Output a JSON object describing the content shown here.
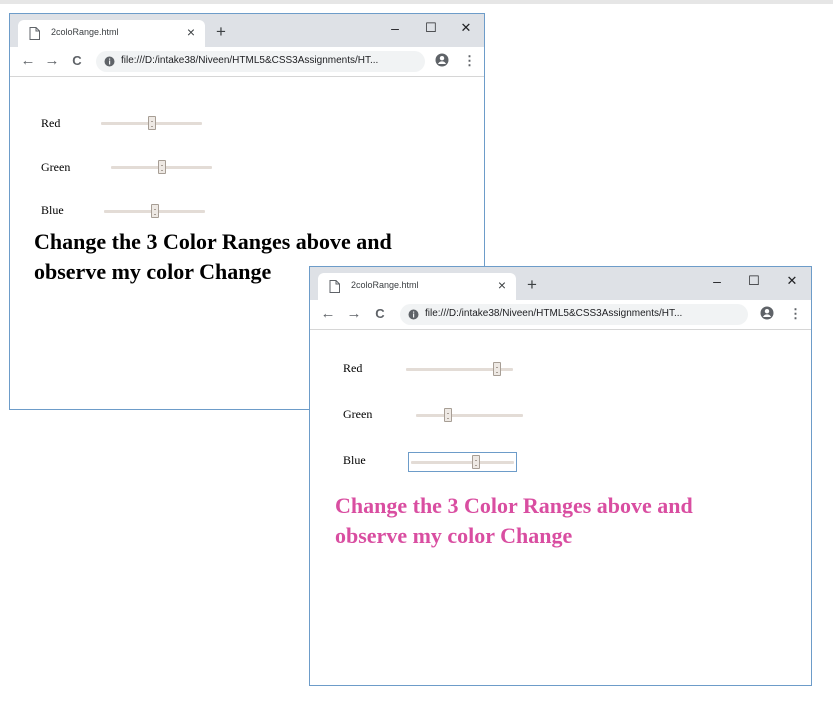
{
  "windows": [
    {
      "tab_title": "2coloRange.html",
      "tab_close": "×",
      "new_tab": "+",
      "controls": {
        "minimize": "–",
        "maximize": "☐",
        "close": "✕"
      },
      "nav": {
        "back": "←",
        "forward": "→",
        "reload": "C"
      },
      "url": "file:///D:/intake38/Niveen/HTML5&CSS3Assignments/HT...",
      "menu": "⋮",
      "sliders": [
        {
          "label": "Red",
          "value": 50
        },
        {
          "label": "Green",
          "value": 50
        },
        {
          "label": "Blue",
          "value": 50
        }
      ],
      "heading": {
        "line1": "Change the 3 Color Ranges above and",
        "line2": "observe my color Change",
        "color": "#000000"
      }
    },
    {
      "tab_title": "2coloRange.html",
      "tab_close": "×",
      "new_tab": "+",
      "controls": {
        "minimize": "–",
        "maximize": "☐",
        "close": "✕"
      },
      "nav": {
        "back": "←",
        "forward": "→",
        "reload": "C"
      },
      "url": "file:///D:/intake38/Niveen/HTML5&CSS3Assignments/HT...",
      "menu": "⋮",
      "sliders": [
        {
          "label": "Red",
          "value": 85
        },
        {
          "label": "Green",
          "value": 30
        },
        {
          "label": "Blue",
          "value": 63,
          "focused": true
        }
      ],
      "heading": {
        "line1": "Change the 3 Color Ranges above and",
        "line2": "observe my color Change",
        "color": "#d94ea1"
      }
    }
  ]
}
